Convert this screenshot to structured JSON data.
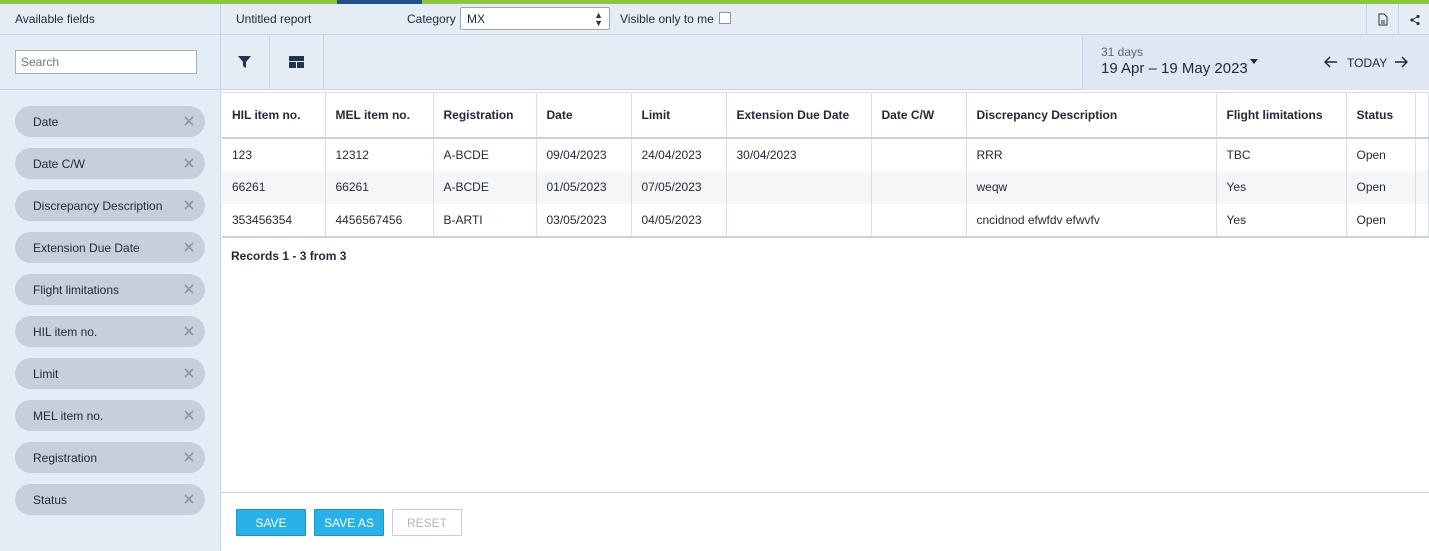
{
  "header": {
    "available_fields": "Available fields",
    "report_title": "Untitled report",
    "category_label": "Category",
    "category_value": "MX",
    "visible_only_label": "Visible only to me",
    "visible_only_checked": false
  },
  "toolbar": {
    "search_placeholder": "Search",
    "range_days": "31 days",
    "range": "19 Apr – 19 May 2023",
    "today_label": "TODAY"
  },
  "sidebar": {
    "fields": [
      {
        "label": "Date"
      },
      {
        "label": "Date C/W"
      },
      {
        "label": "Discrepancy Description"
      },
      {
        "label": "Extension Due Date"
      },
      {
        "label": "Flight limitations"
      },
      {
        "label": "HIL item no."
      },
      {
        "label": "Limit"
      },
      {
        "label": "MEL item no."
      },
      {
        "label": "Registration"
      },
      {
        "label": "Status"
      }
    ]
  },
  "table": {
    "columns": [
      "HIL item no.",
      "MEL item no.",
      "Registration",
      "Date",
      "Limit",
      "Extension Due Date",
      "Date C/W",
      "Discrepancy Description",
      "Flight limitations",
      "Status"
    ],
    "rows": [
      [
        "123",
        "12312",
        "A-BCDE",
        "09/04/2023",
        "24/04/2023",
        "30/04/2023",
        "",
        "RRR",
        "TBC",
        "Open"
      ],
      [
        "66261",
        "66261",
        "A-BCDE",
        "01/05/2023",
        "07/05/2023",
        "",
        "",
        "weqw",
        "Yes",
        "Open"
      ],
      [
        "353456354",
        "4456567456",
        "B-ARTI",
        "03/05/2023",
        "04/05/2023",
        "",
        "",
        "cncidnod efwfdv efwvfv",
        "Yes",
        "Open"
      ]
    ],
    "records_label": "Records 1 - 3 from 3"
  },
  "footer": {
    "save_label": "SAVE",
    "save_as_label": "SAVE AS",
    "reset_label": "RESET"
  },
  "colors": {
    "accent_green": "#8cc63f",
    "accent_blue": "#1e4e8c",
    "button_primary": "#29b0e6",
    "panel_bg": "#e4edf6",
    "pill_bg": "#c6d0db"
  }
}
